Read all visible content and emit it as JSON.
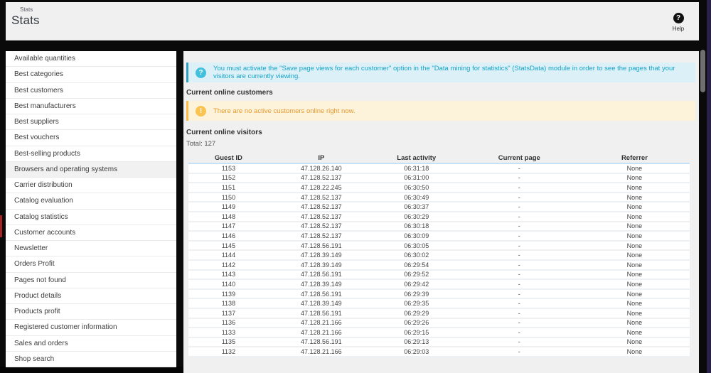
{
  "header": {
    "breadcrumb": "Stats",
    "title": "Stats",
    "help": {
      "icon": "?",
      "label": "Help"
    }
  },
  "sidebar": {
    "items": [
      {
        "label": "Available quantities",
        "active": false
      },
      {
        "label": "Best categories",
        "active": false
      },
      {
        "label": "Best customers",
        "active": false
      },
      {
        "label": "Best manufacturers",
        "active": false
      },
      {
        "label": "Best suppliers",
        "active": false
      },
      {
        "label": "Best vouchers",
        "active": false
      },
      {
        "label": "Best-selling products",
        "active": false
      },
      {
        "label": "Browsers and operating systems",
        "active": true
      },
      {
        "label": "Carrier distribution",
        "active": false
      },
      {
        "label": "Catalog evaluation",
        "active": false
      },
      {
        "label": "Catalog statistics",
        "active": false
      },
      {
        "label": "Customer accounts",
        "active": false
      },
      {
        "label": "Newsletter",
        "active": false
      },
      {
        "label": "Orders Profit",
        "active": false
      },
      {
        "label": "Pages not found",
        "active": false
      },
      {
        "label": "Product details",
        "active": false
      },
      {
        "label": "Products profit",
        "active": false
      },
      {
        "label": "Registered customer information",
        "active": false
      },
      {
        "label": "Sales and orders",
        "active": false
      },
      {
        "label": "Shop search",
        "active": false
      }
    ]
  },
  "main": {
    "info_banner": {
      "icon": "?",
      "text": "You must activate the \"Save page views for each customer\" option in the \"Data mining for statistics\" (StatsData) module in order to see the pages that your visitors are currently viewing."
    },
    "customers_section_title": "Current online customers",
    "warning_banner": {
      "icon": "!",
      "text": "There are no active customers online right now."
    },
    "visitors_section_title": "Current online visitors",
    "total_label": "Total: 127",
    "table": {
      "columns": [
        "Guest ID",
        "IP",
        "Last activity",
        "Current page",
        "Referrer"
      ],
      "rows": [
        [
          "1153",
          "47.128.26.140",
          "06:31:18",
          "-",
          "None"
        ],
        [
          "1152",
          "47.128.52.137",
          "06:31:00",
          "-",
          "None"
        ],
        [
          "1151",
          "47.128.22.245",
          "06:30:50",
          "-",
          "None"
        ],
        [
          "1150",
          "47.128.52.137",
          "06:30:49",
          "-",
          "None"
        ],
        [
          "1149",
          "47.128.52.137",
          "06:30:37",
          "-",
          "None"
        ],
        [
          "1148",
          "47.128.52.137",
          "06:30:29",
          "-",
          "None"
        ],
        [
          "1147",
          "47.128.52.137",
          "06:30:18",
          "-",
          "None"
        ],
        [
          "1146",
          "47.128.52.137",
          "06:30:09",
          "-",
          "None"
        ],
        [
          "1145",
          "47.128.56.191",
          "06:30:05",
          "-",
          "None"
        ],
        [
          "1144",
          "47.128.39.149",
          "06:30:02",
          "-",
          "None"
        ],
        [
          "1142",
          "47.128.39.149",
          "06:29:54",
          "-",
          "None"
        ],
        [
          "1143",
          "47.128.56.191",
          "06:29:52",
          "-",
          "None"
        ],
        [
          "1140",
          "47.128.39.149",
          "06:29:42",
          "-",
          "None"
        ],
        [
          "1139",
          "47.128.56.191",
          "06:29:39",
          "-",
          "None"
        ],
        [
          "1138",
          "47.128.39.149",
          "06:29:35",
          "-",
          "None"
        ],
        [
          "1137",
          "47.128.56.191",
          "06:29:29",
          "-",
          "None"
        ],
        [
          "1136",
          "47.128.21.166",
          "06:29:26",
          "-",
          "None"
        ],
        [
          "1133",
          "47.128.21.166",
          "06:29:15",
          "-",
          "None"
        ],
        [
          "1135",
          "47.128.56.191",
          "06:29:13",
          "-",
          "None"
        ],
        [
          "1132",
          "47.128.21.166",
          "06:29:03",
          "-",
          "None"
        ]
      ]
    }
  },
  "colors": {
    "info_accent": "#2f9fbd",
    "info_bg": "#dcf0f7",
    "info_text": "#16a4c8",
    "warning_accent": "#fbbb45",
    "warning_bg": "#fdf3da",
    "warning_text": "#e59a30",
    "table_header_border": "#c4e1f5",
    "frame_purple": "#2a2148"
  }
}
